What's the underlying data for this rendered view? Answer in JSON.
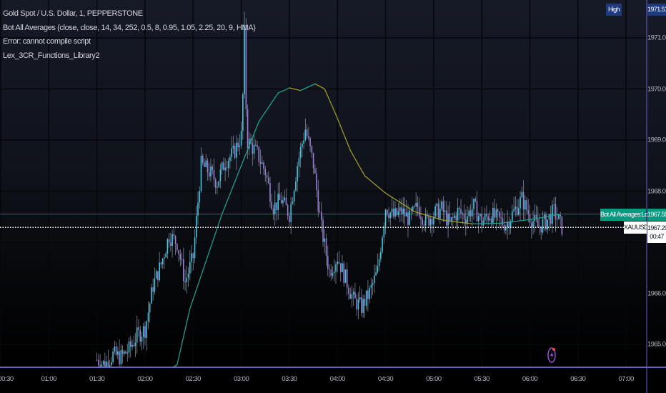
{
  "legend": {
    "symbol": "Gold Spot / U.S. Dollar, 1, PEPPERSTONE",
    "indicator": "Bot All Averages (close, close, 14, 34, 252, 0.5, 8, 0.95, 1.05, 2.25, 20, 9, HMA)",
    "error": "Error: cannot compile script",
    "library": "Lex_3CR_Functions_Library2"
  },
  "price_axis": {
    "ticks": [
      "1971.00",
      "1970.00",
      "1969.00",
      "1968.00",
      "1966.00",
      "1965.00"
    ],
    "tick_values": [
      1971,
      1970,
      1969,
      1968,
      1966,
      1965
    ],
    "high_label": "High",
    "high_value": "1971.51",
    "signal_label": "Bot All Averages:Long",
    "signal_value": "1967.55",
    "symbol_label": "XAUUSD",
    "last_price": "1967.29",
    "countdown": "00:47"
  },
  "time_axis": {
    "ticks": [
      "00:30",
      "01:00",
      "01:30",
      "02:00",
      "02:30",
      "03:00",
      "03:30",
      "04:00",
      "04:30",
      "05:00",
      "05:30",
      "06:00",
      "06:30",
      "07:00"
    ]
  },
  "colors": {
    "up": "#3ec9e0",
    "down": "#9a7fd8",
    "ma_up": "#1f9e8a",
    "ma_down": "#9a9a2a",
    "signal": "#089981",
    "high_badge": "#1e3a7a",
    "axis_line": "#6c5fc7",
    "grid": "#000000"
  },
  "chart_data": {
    "type": "candlestick",
    "title": "Gold Spot / U.S. Dollar, 1, PEPPERSTONE",
    "interval": "1 minute",
    "ylim": [
      1964.55,
      1971.74
    ],
    "xlim": [
      "00:30",
      "07:15"
    ],
    "close_5m_start": "01:30",
    "close_5m": [
      1964.7,
      1964.6,
      1964.8,
      1964.75,
      1964.9,
      1965.17,
      1965.3,
      1966.15,
      1966.57,
      1967.13,
      1966.99,
      1966.22,
      1966.71,
      1968.52,
      1968.38,
      1968.17,
      1968.59,
      1968.73,
      1969.08,
      1968.94,
      1968.73,
      1968.38,
      1967.69,
      1967.83,
      1967.55,
      1968.52,
      1969.22,
      1968.52,
      1967.27,
      1966.43,
      1966.71,
      1966.29,
      1965.87,
      1965.73,
      1966.01,
      1966.43,
      1967.69,
      1967.5,
      1967.6,
      1967.45,
      1967.7,
      1967.4,
      1967.55,
      1967.65,
      1967.35,
      1967.6,
      1967.5,
      1967.7,
      1967.4,
      1967.55,
      1967.45,
      1967.35,
      1967.6,
      1967.85,
      1967.5,
      1967.3,
      1967.4,
      1967.6,
      1967.29
    ],
    "session_high": {
      "time": "03:02",
      "price": 1971.51
    },
    "moving_average": {
      "name": "Bot All Averages (HMA)",
      "points": [
        [
          "02:17",
          1964.55
        ],
        [
          "02:20",
          1964.6
        ],
        [
          "02:28",
          1965.7
        ],
        [
          "02:48",
          1967.55
        ],
        [
          "03:00",
          1968.5
        ],
        [
          "03:11",
          1969.36
        ],
        [
          "03:23",
          1969.92
        ],
        [
          "03:30",
          1970.02
        ],
        [
          "03:37",
          1969.97
        ],
        [
          "03:46",
          1970.1
        ],
        [
          "03:52",
          1970.0
        ],
        [
          "03:59",
          1969.5
        ],
        [
          "04:08",
          1968.8
        ],
        [
          "04:17",
          1968.3
        ],
        [
          "04:30",
          1967.96
        ],
        [
          "04:48",
          1967.6
        ],
        [
          "05:06",
          1967.43
        ],
        [
          "05:24",
          1967.36
        ],
        [
          "05:41",
          1967.37
        ],
        [
          "05:59",
          1967.44
        ],
        [
          "06:13",
          1967.51
        ],
        [
          "06:19",
          1967.55
        ]
      ]
    },
    "horizontal_lines": [
      {
        "name": "Bot All Averages:Long",
        "price": 1967.55
      },
      {
        "name": "last price",
        "price": 1967.29
      }
    ]
  }
}
